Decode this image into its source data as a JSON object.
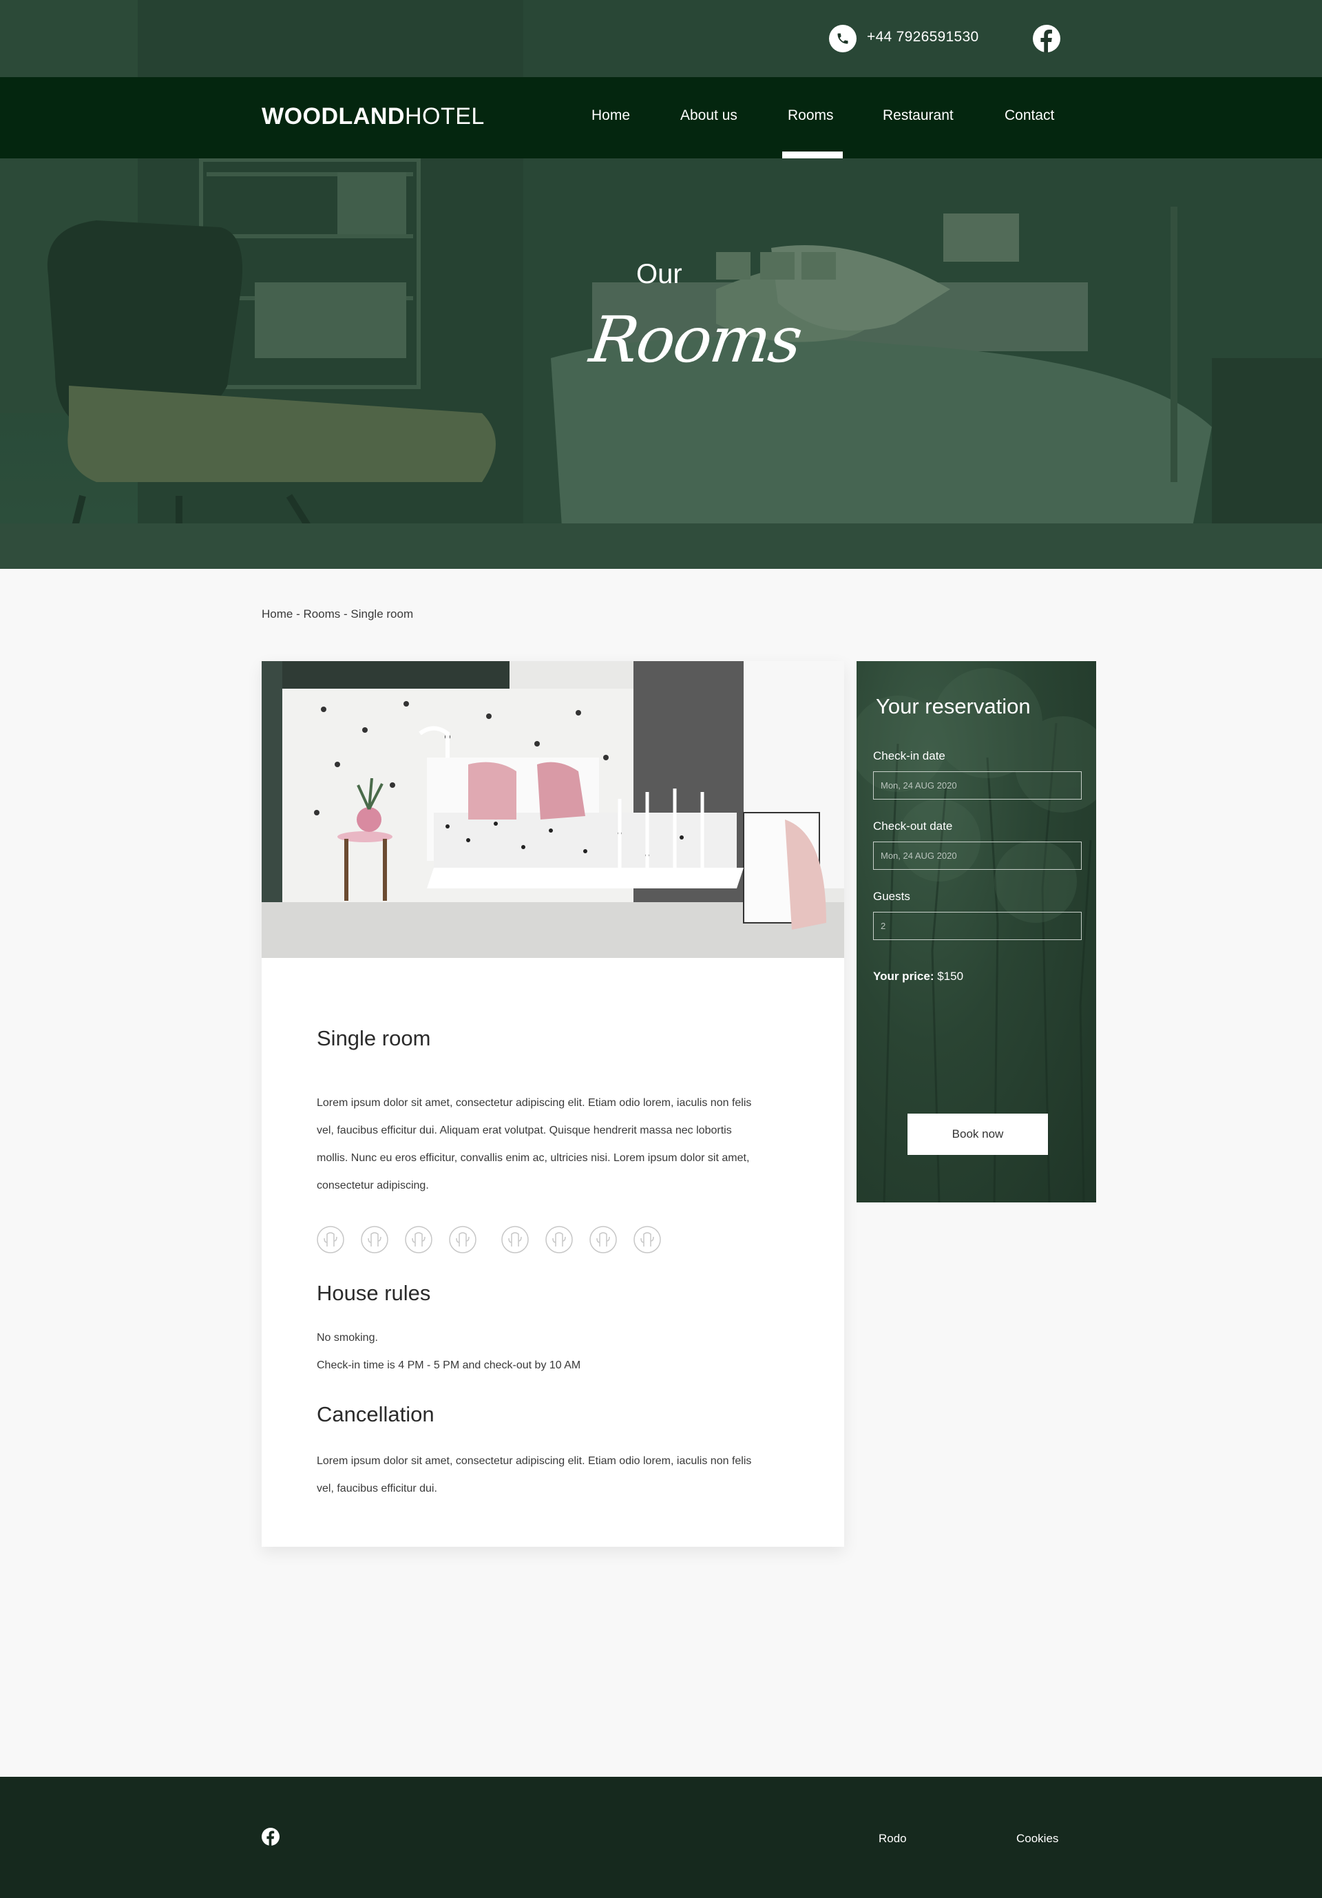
{
  "topbar": {
    "phone_icon": "phone-icon",
    "phone": "+44 7926591530",
    "social_icon": "facebook-icon"
  },
  "logo": {
    "bold": "WOODLAND",
    "light": "HOTEL"
  },
  "nav": {
    "items": [
      {
        "label": "Home"
      },
      {
        "label": "About us"
      },
      {
        "label": "Rooms",
        "active": true
      },
      {
        "label": "Restaurant"
      },
      {
        "label": "Contact"
      }
    ]
  },
  "hero": {
    "kicker": "Our",
    "title": "Rooms"
  },
  "breadcrumb": "Home - Rooms - Single room",
  "room": {
    "title": "Single room",
    "description": "Lorem ipsum dolor sit amet, consectetur adipiscing elit. Etiam odio lorem, iaculis non felis vel, faucibus efficitur dui. Aliquam erat volutpat. Quisque hendrerit massa nec lobortis mollis. Nunc eu eros efficitur, convallis enim ac, ultricies nisi. Lorem ipsum dolor sit amet, consectetur adipiscing.",
    "amenity_icon": "cactus-icon",
    "amenity_count": 8,
    "rules_title": "House rules",
    "rules": [
      "No smoking.",
      "Check-in time is 4 PM - 5 PM and check-out by 10 AM"
    ],
    "cancellation_title": "Cancellation",
    "cancellation_text": "Lorem ipsum dolor sit amet, consectetur adipiscing elit. Etiam odio lorem, iaculis non felis vel, faucibus efficitur dui."
  },
  "reservation": {
    "title": "Your reservation",
    "checkin_label": "Check-in date",
    "checkin_value": "Mon, 24 AUG 2020",
    "checkout_label": "Check-out date",
    "checkout_value": "Mon, 24 AUG 2020",
    "guests_label": "Guests",
    "guests_value": "2",
    "price_label": "Your price:",
    "price_value": "$150",
    "book_label": "Book now"
  },
  "footer": {
    "social_icon": "facebook-icon",
    "links": [
      "Rodo",
      "Cookies"
    ]
  },
  "colors": {
    "nav_bg": "#04260f",
    "footer_bg": "#16291e",
    "hero_overlay": "#2c4d3b",
    "reservation_bg": "#2a4433"
  }
}
